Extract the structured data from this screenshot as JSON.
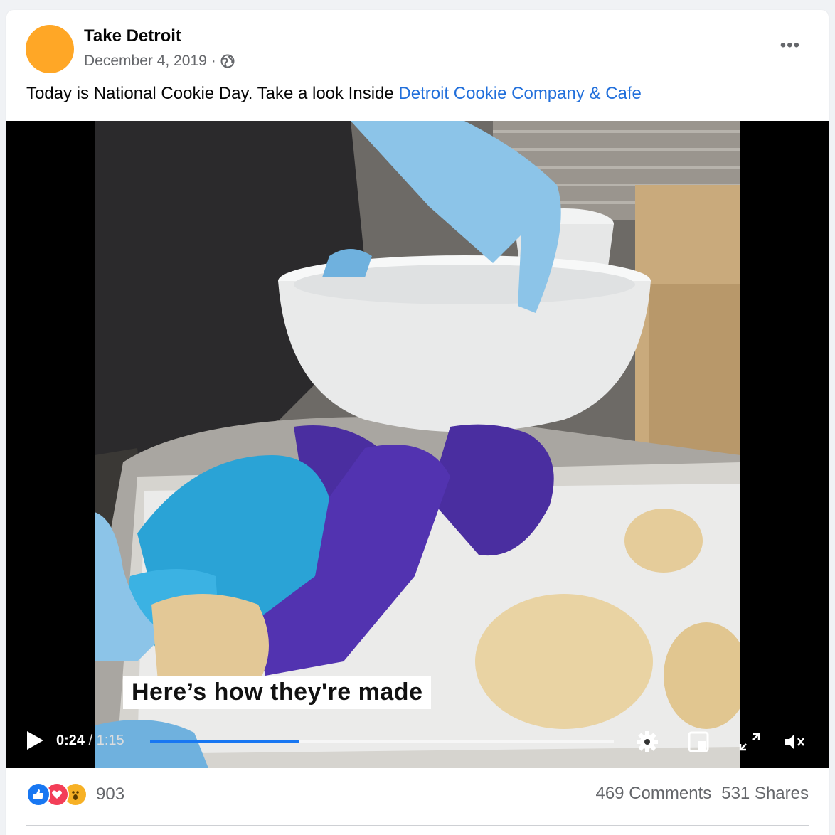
{
  "post": {
    "page_name": "Take Detroit",
    "date": "December 4, 2019",
    "separator": "·",
    "privacy_icon": "globe-icon",
    "more_icon": "ellipsis-icon",
    "more_label": "•••",
    "caption_text": "Today is National Cookie Day. Take a look Inside ",
    "caption_link": "Detroit Cookie Company & Cafe",
    "avatar_color": "#ffa726",
    "link_color": "#216fdb"
  },
  "video": {
    "subtitle": "Here’s how they're made",
    "current_time": "0:24",
    "time_separator": " / ",
    "total_time": "1:15",
    "progress_percent": 32,
    "progress_color": "#1877f2",
    "controls": [
      "play-icon",
      "settings-icon",
      "miniplayer-icon",
      "fullscreen-icon",
      "muted-icon"
    ]
  },
  "footer": {
    "reactions": [
      "like-icon",
      "love-icon",
      "wow-icon"
    ],
    "reaction_count": "903",
    "comments": "469 Comments",
    "shares": "531 Shares"
  }
}
